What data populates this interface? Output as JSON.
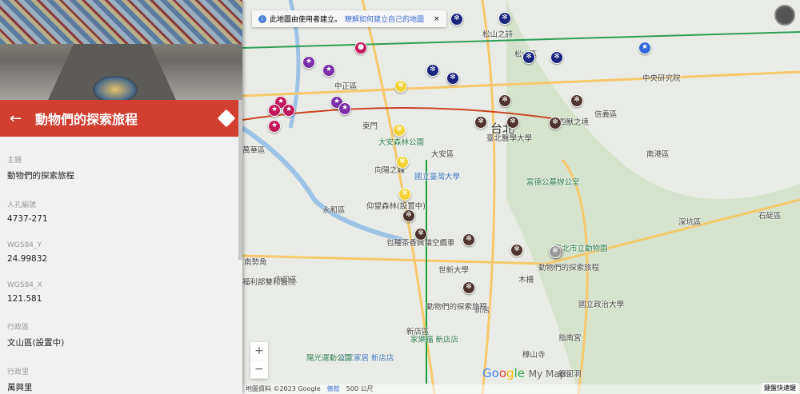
{
  "panel": {
    "title": "動物們的探索旅程",
    "fields": [
      {
        "key": "主題",
        "value": "動物們的探索旅程"
      },
      {
        "key": "人孔編號",
        "value": "4737-271"
      },
      {
        "key": "WGS84_Y",
        "value": "24.99832"
      },
      {
        "key": "WGS84_X",
        "value": "121.581"
      },
      {
        "key": "行政區",
        "value": "文山區(設置中)"
      },
      {
        "key": "行政里",
        "value": "萬興里"
      }
    ]
  },
  "notice": {
    "text": "此地圖由使用者建立。",
    "link": "瞭解如何建立自己的地圖",
    "close": "×"
  },
  "map": {
    "labels": [
      "台北",
      "大安區",
      "南港區",
      "深坑區",
      "石碇區",
      "新店區",
      "永和區",
      "中和區",
      "松山區",
      "信義區",
      "臺北市立動物園",
      "動物們的探索旅程",
      "國立政治大學",
      "世新大學",
      "國立臺灣大學",
      "大安森林公園",
      "中正區",
      "萬華區",
      "東門",
      "新店",
      "木柵",
      "指南宮",
      "樟山寺",
      "銀河洞",
      "家樂福 新店店",
      "宜家家居 新店店",
      "陽光運動公園",
      "中央研究院",
      "富德公墓辦公室",
      "南勢角",
      "福利部雙和醫院",
      "動物們的探索旅程",
      "四獸之境",
      "松山之詩",
      "臺北醫學大學",
      "向陽之森",
      "仰望森林(設置中)",
      "包種茶香與貓空纜車"
    ],
    "zoom_in": "+",
    "zoom_out": "−",
    "attribution": "地圖資料 ©2023 Google",
    "terms": "條款",
    "scale": "500 公尺",
    "logo": "Google My Maps",
    "shortcut": "鍵盤快速鍵"
  },
  "colors": {
    "header": "#d23f31",
    "purple": "#7b2fa8",
    "red": "#c2185b",
    "navy": "#1a237e",
    "brown": "#4e342e",
    "yellow": "#f2d335",
    "blue": "#3367d6"
  }
}
